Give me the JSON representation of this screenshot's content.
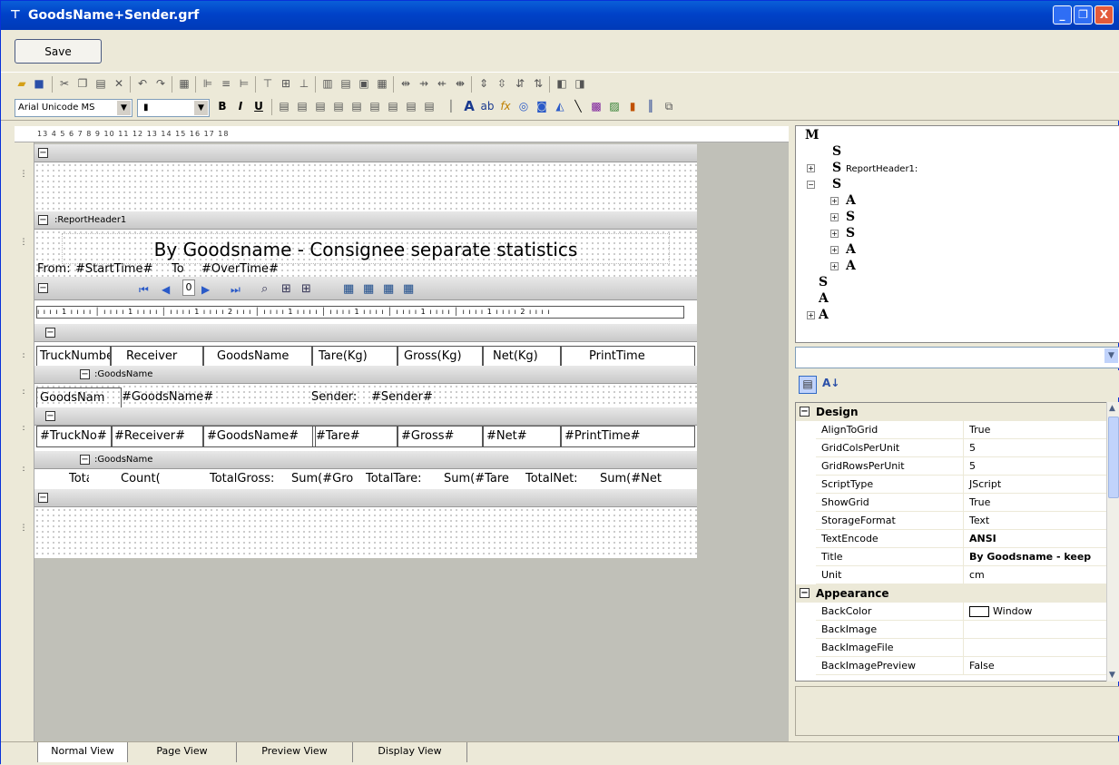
{
  "window": {
    "title": "GoodsName+Sender.grf",
    "min": "_",
    "max": "❐",
    "close": "X"
  },
  "toolbar": {
    "save_label": "Save",
    "font_name": "Arial Unicode MS",
    "font_size": "▮"
  },
  "ruler": {
    "marks": "13 4 5 6 7 8 9 10 11 12 13 14 15 16 17 18"
  },
  "bands": {
    "report_header_label": ":ReportHeader1",
    "title_text": "By Goodsname - Consignee separate statistics",
    "from_label": "From:",
    "start_time": "#StartTime#",
    "to_label": "To",
    "over_time": "#OverTime#",
    "nav_page": "0",
    "column_headers": [
      "TruckNumber",
      "Receiver",
      "GoodsName",
      "Tare(Kg)",
      "Gross(Kg)",
      "Net(Kg)",
      "PrintTime"
    ],
    "group_label": ":GoodsName",
    "group_header_cells": [
      "GoodsNam",
      "#GoodsName#",
      "Sender:",
      "#Sender#"
    ],
    "detail_cells": [
      "#TruckNo#",
      "#Receiver#",
      "#GoodsName#",
      "#Tare#",
      "#Gross#",
      "#Net#",
      "#PrintTime#"
    ],
    "group_footer_label": ":GoodsName",
    "footer_cells": [
      "Total:",
      "Count(",
      "TotalGross:",
      "Sum(#Gro",
      "TotalTare:",
      "Sum(#Tare",
      "TotalNet:",
      "Sum(#Net"
    ]
  },
  "tree": {
    "root": "M",
    "nodes": [
      "S",
      "S",
      "S",
      "A",
      "S",
      "S",
      "A",
      "A",
      "S",
      "A",
      "A"
    ],
    "report_header_label": "ReportHeader1:"
  },
  "props": {
    "categories": [
      "Design",
      "Appearance"
    ],
    "design": [
      {
        "name": "AlignToGrid",
        "value": "True"
      },
      {
        "name": "GridColsPerUnit",
        "value": "5"
      },
      {
        "name": "GridRowsPerUnit",
        "value": "5"
      },
      {
        "name": "ScriptType",
        "value": "JScript"
      },
      {
        "name": "ShowGrid",
        "value": "True"
      },
      {
        "name": "StorageFormat",
        "value": "Text"
      },
      {
        "name": "TextEncode",
        "value": "ANSI"
      },
      {
        "name": "Title",
        "value": "By Goodsname - keep"
      },
      {
        "name": "Unit",
        "value": "cm"
      }
    ],
    "appearance": [
      {
        "name": "BackColor",
        "value": "Window"
      },
      {
        "name": "BackImage",
        "value": ""
      },
      {
        "name": "BackImageFile",
        "value": ""
      },
      {
        "name": "BackImagePreview",
        "value": "False"
      }
    ]
  },
  "tabs": [
    "Normal View",
    "Page View",
    "Preview View",
    "Display View"
  ]
}
